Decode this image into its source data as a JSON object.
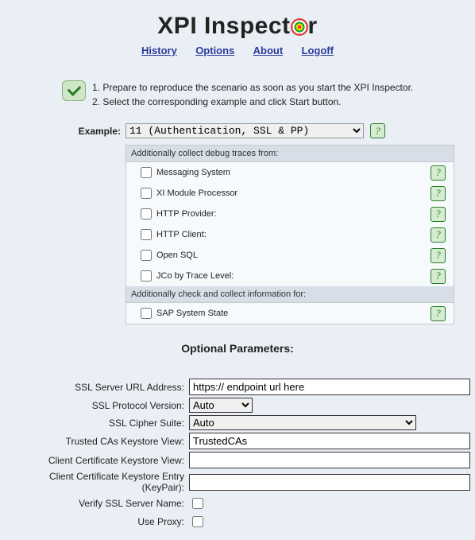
{
  "title_pre": "XPI Inspect",
  "title_post": "r",
  "nav": {
    "history": "History",
    "options": "Options",
    "about": "About",
    "logoff": "Logoff"
  },
  "intro": {
    "line1": "1. Prepare to reproduce the scenario as soon as you start the XPI Inspector.",
    "line2": "2. Select the corresponding example and click Start button."
  },
  "example_label": "Example:",
  "example_selected": "11 (Authentication, SSL & PP)",
  "debug_header": "Additionally collect debug traces from:",
  "debug_items": [
    "Messaging System",
    "XI Module Processor",
    "HTTP Provider:",
    "HTTP Client:",
    "Open SQL",
    "JCo by Trace Level:"
  ],
  "info_header": "Additionally check and collect information for:",
  "info_items": [
    "SAP System State"
  ],
  "optional_title": "Optional Parameters:",
  "fields": {
    "ssl_url_label": "SSL Server URL Address:",
    "ssl_url_value": "https:// endpoint url here",
    "ssl_proto_label": "SSL Protocol Version:",
    "ssl_proto_value": "Auto",
    "ssl_cipher_label": "SSL Cipher Suite:",
    "ssl_cipher_value": "Auto",
    "trusted_label": "Trusted CAs Keystore View:",
    "trusted_value": "TrustedCAs",
    "client_ks_view_label": "Client Certificate Keystore View:",
    "client_ks_view_value": "",
    "client_ks_entry_label": "Client Certificate Keystore Entry (KeyPair):",
    "client_ks_entry_value": "",
    "verify_label": "Verify SSL Server Name:",
    "proxy_label": "Use Proxy:"
  }
}
